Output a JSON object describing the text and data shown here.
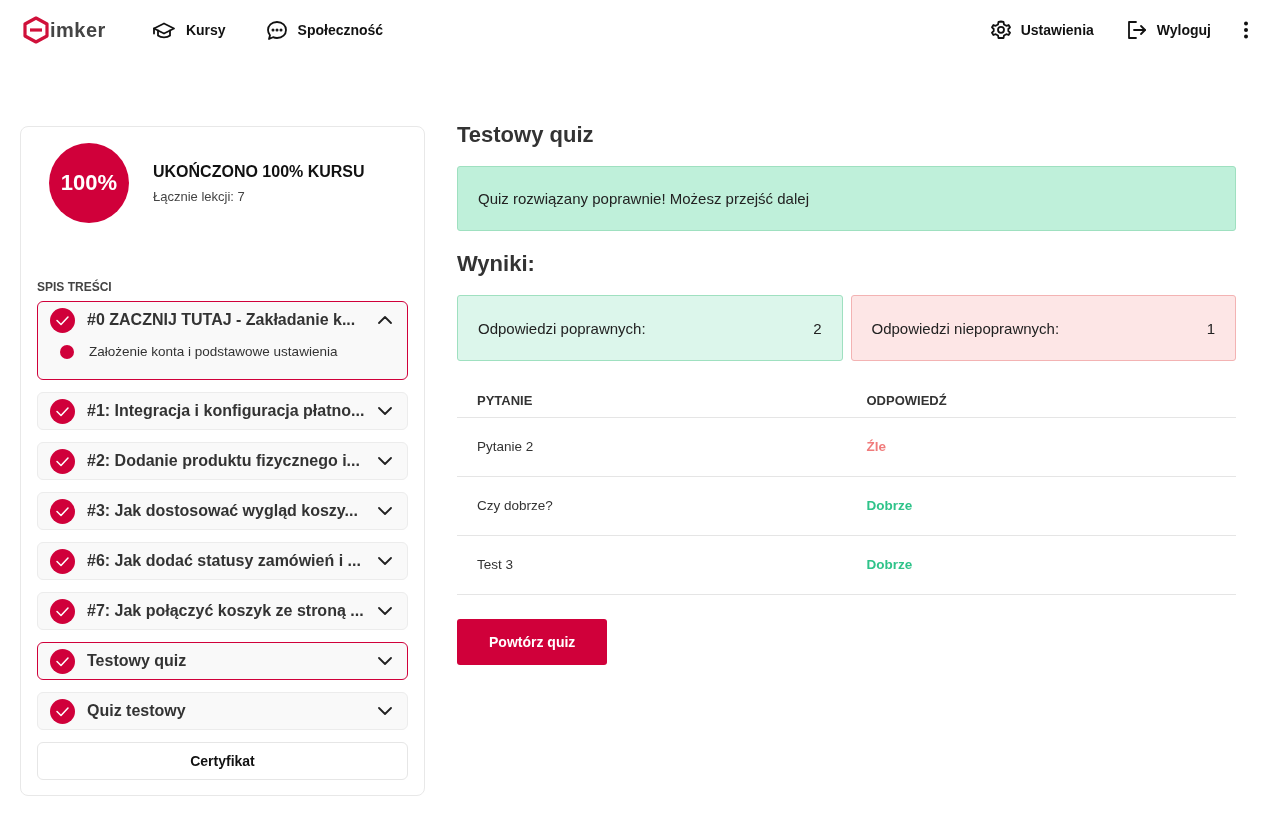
{
  "header": {
    "logo_text": "imker",
    "nav": [
      {
        "label": "Kursy",
        "kind": "courses"
      },
      {
        "label": "Społeczność",
        "kind": "community"
      }
    ],
    "actions": [
      {
        "label": "Ustawienia",
        "kind": "settings"
      },
      {
        "label": "Wyloguj",
        "kind": "logout"
      }
    ]
  },
  "sidebar": {
    "progress": {
      "badge": "100%",
      "title": "UKOŃCZONO 100% KURSU",
      "lessons": "Łącznie lekcji: 7"
    },
    "toc_heading": "SPIS TREŚCI",
    "chapters": [
      {
        "title": "#0 ZACZNIJ TUTAJ - Zakładanie k...",
        "completed": true,
        "expanded": true,
        "highlighted": true,
        "children": [
          {
            "title": "Założenie konta i podstawowe ustawienia"
          }
        ]
      },
      {
        "title": "#1: Integracja i konfiguracja płatno...",
        "completed": true,
        "expanded": false,
        "highlighted": false
      },
      {
        "title": "#2: Dodanie produktu fizycznego i...",
        "completed": true,
        "expanded": false,
        "highlighted": false
      },
      {
        "title": "#3: Jak dostosować wygląd koszy...",
        "completed": true,
        "expanded": false,
        "highlighted": false
      },
      {
        "title": "#6: Jak dodać statusy zamówień i ...",
        "completed": true,
        "expanded": false,
        "highlighted": false
      },
      {
        "title": "#7: Jak połączyć koszyk ze stroną ...",
        "completed": true,
        "expanded": false,
        "highlighted": false
      },
      {
        "title": "Testowy quiz",
        "completed": true,
        "expanded": false,
        "highlighted": true
      },
      {
        "title": "Quiz testowy",
        "completed": true,
        "expanded": false,
        "highlighted": false
      }
    ],
    "certificate_button": "Certyfikat"
  },
  "main": {
    "title": "Testowy quiz",
    "alert": {
      "kind": "success",
      "text": "Quiz rozwiązany poprawnie! Możesz przejść dalej"
    },
    "results_heading": "Wyniki:",
    "summary": [
      {
        "kind": "correct",
        "label": "Odpowiedzi poprawnych:",
        "count": "2"
      },
      {
        "kind": "wrong",
        "label": "Odpowiedzi niepoprawnych:",
        "count": "1"
      }
    ],
    "table": {
      "columns": [
        "PYTANIE",
        "ODPOWIEDŹ"
      ],
      "rows": [
        {
          "question": "Pytanie 2",
          "answer": "Źle",
          "kind": "wrong"
        },
        {
          "question": "Czy dobrze?",
          "answer": "Dobrze",
          "kind": "correct"
        },
        {
          "question": "Test 3",
          "answer": "Dobrze",
          "kind": "correct"
        }
      ]
    },
    "retry_button": "Powtórz quiz"
  }
}
